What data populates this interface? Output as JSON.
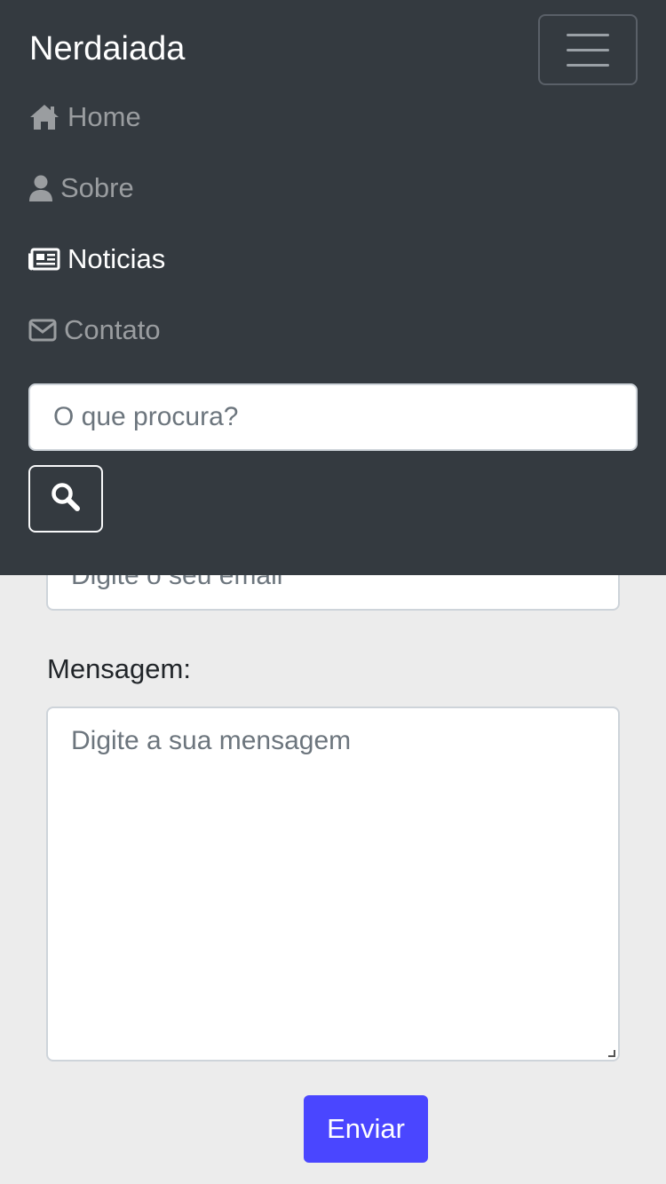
{
  "navbar": {
    "brand": "Nerdaiada",
    "toggler_icon": "hamburger-icon",
    "items": [
      {
        "label": "Home",
        "icon": "home-icon",
        "active": false
      },
      {
        "label": "Sobre",
        "icon": "user-icon",
        "active": false
      },
      {
        "label": "Noticias",
        "icon": "newspaper-icon",
        "active": true
      },
      {
        "label": "Contato",
        "icon": "envelope-icon",
        "active": false
      }
    ],
    "search": {
      "placeholder": "O que procura?",
      "button_icon": "search-icon"
    }
  },
  "form": {
    "email_placeholder": "Digite o seu email",
    "message_label": "Mensagem:",
    "message_placeholder": "Digite a sua mensagem",
    "submit_label": "Enviar"
  },
  "colors": {
    "navbar_bg": "#343a40",
    "page_bg": "#ececec",
    "nav_inactive": "#9a9da0",
    "nav_active": "#ffffff",
    "submit_bg": "#4a46ff"
  }
}
